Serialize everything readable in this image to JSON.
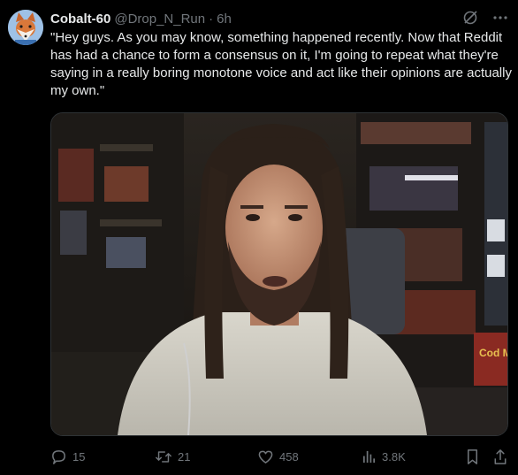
{
  "tweet": {
    "author": {
      "display_name": "Cobalt-60",
      "handle": "@Drop_N_Run",
      "separator": "·",
      "time": "6h",
      "avatar_icon": "fox-avatar"
    },
    "text": "\"Hey guys. As you may know, something happened recently. Now that Reddit has had a chance to form a consensus on it, I'm going to repeat what they're saying in a really boring monotone voice and act like their opinions are actually my own.\"",
    "media": {
      "type": "photo",
      "poster_text": "Cod M"
    },
    "metrics": {
      "replies": "15",
      "retweets": "21",
      "likes": "458",
      "views": "3.8K"
    }
  },
  "colors": {
    "background": "#000000",
    "text_primary": "#e7e9ea",
    "text_secondary": "#71767b",
    "border": "#2f3336"
  }
}
